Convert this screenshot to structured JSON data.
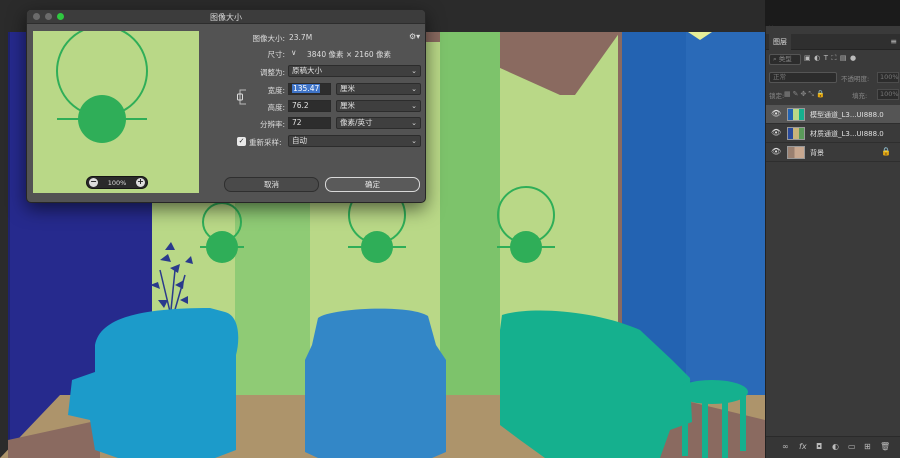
{
  "dialog": {
    "title": "图像大小",
    "image_size_label": "图像大小:",
    "image_size_value": "23.7M",
    "dimensions_label": "尺寸:",
    "dimensions_value": "3840 像素 × 2160 像素",
    "fit_label": "调整为:",
    "fit_value": "原稿大小",
    "width_label": "宽度:",
    "width_value": "135.47",
    "width_unit": "厘米",
    "height_label": "高度:",
    "height_value": "76.2",
    "height_unit": "厘米",
    "resolution_label": "分辨率:",
    "resolution_value": "72",
    "resolution_unit": "像素/英寸",
    "resample_label": "重新采样:",
    "resample_value": "自动",
    "zoom": "100%",
    "cancel_label": "取消",
    "ok_label": "确定"
  },
  "layers_panel": {
    "collapse_left": "×",
    "collapse_right": "«",
    "tab_label": "图层",
    "filter_label": "类型",
    "blend_mode": "正常",
    "opacity_label": "不透明度:",
    "opacity_value": "100%",
    "lock_label": "锁定:",
    "fill_label": "填充:",
    "fill_value": "100%",
    "layers": [
      {
        "name": "模型通道_L3...UI888.0",
        "selected": true,
        "locked": false
      },
      {
        "name": "材质通道_L3...UI888.0",
        "selected": false,
        "locked": false
      },
      {
        "name": "背景",
        "selected": false,
        "locked": true
      }
    ],
    "footer_icons": [
      "link-icon",
      "fx-icon",
      "mask-icon",
      "adjustment-icon",
      "group-icon",
      "new-layer-icon",
      "trash-icon"
    ]
  },
  "colors": {
    "canvas_background": "#2b2b2b",
    "scene_wall": "#b9d887",
    "scene_pillar": "#7dc36b",
    "scene_left_wall": "#262a8d",
    "scene_right_wall": "#2363b2",
    "scene_floor": "#ad946b",
    "car_left": "#1c9bca",
    "car_center": "#3387c7",
    "car_right": "#15b08e",
    "lamp_green": "#2fae58",
    "dialog_bg": "#535353",
    "selection_blue": "#3f74c7"
  }
}
